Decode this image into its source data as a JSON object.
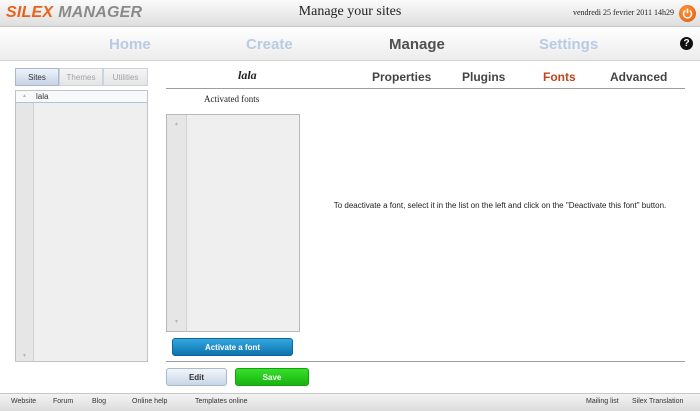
{
  "header": {
    "logo_part1": "SILEX",
    "logo_part2": "MANAGER",
    "title": "Manage your sites",
    "date": "vendredi 25 fevrier 2011 14h29"
  },
  "nav": {
    "home": "Home",
    "create": "Create",
    "manage": "Manage",
    "settings": "Settings",
    "help": "?"
  },
  "left_panel": {
    "tabs": [
      "Sites",
      "Themes",
      "Utilities"
    ],
    "sites": [
      "lala"
    ]
  },
  "site": {
    "name": "lala",
    "tabs": [
      "Properties",
      "Plugins",
      "Fonts",
      "Advanced"
    ],
    "active_tab": "Fonts"
  },
  "fonts": {
    "list_title": "Activated fonts",
    "activate_label": "Activate a font",
    "info": "To deactivate a font, select it in the list on the left and click on the \"Deactivate this font\" button."
  },
  "actions": {
    "edit": "Edit",
    "save": "Save"
  },
  "footer": {
    "links_left": [
      "Website",
      "Forum",
      "Blog",
      "Online help",
      "Templates online"
    ],
    "links_right": [
      "Mailing list",
      "Silex Translation"
    ]
  },
  "colors": {
    "brand_orange": "#e8621c",
    "nav_inactive": "#b9cbe2",
    "active_tab": "#c0441c",
    "activate_blue": "#0c73ad",
    "save_green": "#18b30f"
  }
}
